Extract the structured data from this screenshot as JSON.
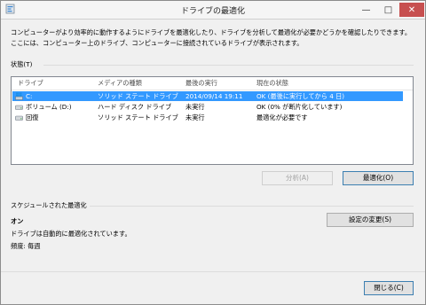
{
  "window": {
    "title": "ドライブの最適化",
    "minimize_glyph": "—",
    "maximize_glyph": "□",
    "close_glyph": "✕"
  },
  "description": "コンピューターがより効率的に動作するようにドライブを最適化したり、ドライブを分析して最適化が必要かどうかを確認したりできます。ここには、コンピューター上のドライブ、コンピューターに接続されているドライブが表示されます。",
  "status": {
    "label": "状態(T)",
    "columns": [
      "ドライブ",
      "メディアの種類",
      "最後の実行",
      "現在の状態"
    ],
    "rows": [
      {
        "drive": "C:",
        "media": "ソリッド ステート ドライブ",
        "last_run": "2014/09/14 19:11",
        "state": "OK (最後に実行してから 4 日)",
        "icon": "windows-drive-icon",
        "selected": true
      },
      {
        "drive": "ボリューム (D:)",
        "media": "ハード ディスク ドライブ",
        "last_run": "未実行",
        "state": "OK (0% が断片化しています)",
        "icon": "hard-drive-icon",
        "selected": false
      },
      {
        "drive": "回復",
        "media": "ソリッド ステート ドライブ",
        "last_run": "未実行",
        "state": "最適化が必要です",
        "icon": "hard-drive-icon",
        "selected": false
      }
    ]
  },
  "buttons": {
    "analyze": "分析(A)",
    "optimize": "最適化(O)",
    "change_settings": "設定の変更(S)",
    "close": "閉じる(C)"
  },
  "schedule": {
    "label": "スケジュールされた最適化",
    "state": "オン",
    "detail": "ドライブは自動的に最適化されています。",
    "frequency": "頻度: 毎週"
  },
  "colors": {
    "selection": "#3399ff",
    "close_button": "#c75050"
  }
}
